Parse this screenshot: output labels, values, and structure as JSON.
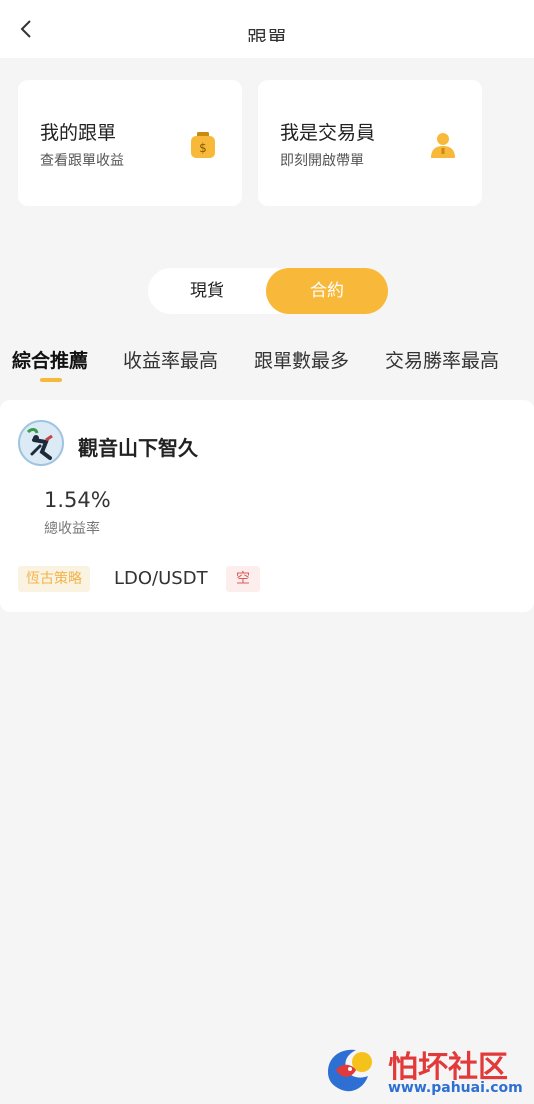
{
  "header": {
    "title": "跟單",
    "back_icon": "chevron-left-icon"
  },
  "cards": {
    "my_copy": {
      "title": "我的跟單",
      "subtitle": "查看跟單收益",
      "icon": "wallet-icon"
    },
    "trader": {
      "title": "我是交易員",
      "subtitle": "即刻開啟帶單",
      "icon": "user-icon"
    }
  },
  "segment": {
    "spot": "現貨",
    "contract": "合約",
    "selected": "合約"
  },
  "tabs": [
    {
      "label": "綜合推薦",
      "active": true
    },
    {
      "label": "收益率最高",
      "active": false
    },
    {
      "label": "跟單數最多",
      "active": false
    },
    {
      "label": "交易勝率最高",
      "active": false
    }
  ],
  "trader": {
    "name": "觀音山下智久",
    "total_return": "1.54%",
    "total_return_label": "總收益率",
    "strategy_tag": "恆古策略",
    "pair": "LDO/USDT",
    "side_tag": "空"
  },
  "watermark": {
    "text": "怕坏社区",
    "url": "www.pahuai.com"
  },
  "colors": {
    "accent": "#f8b93b",
    "background": "#f5f5f5",
    "short_red": "#e05a5a"
  }
}
